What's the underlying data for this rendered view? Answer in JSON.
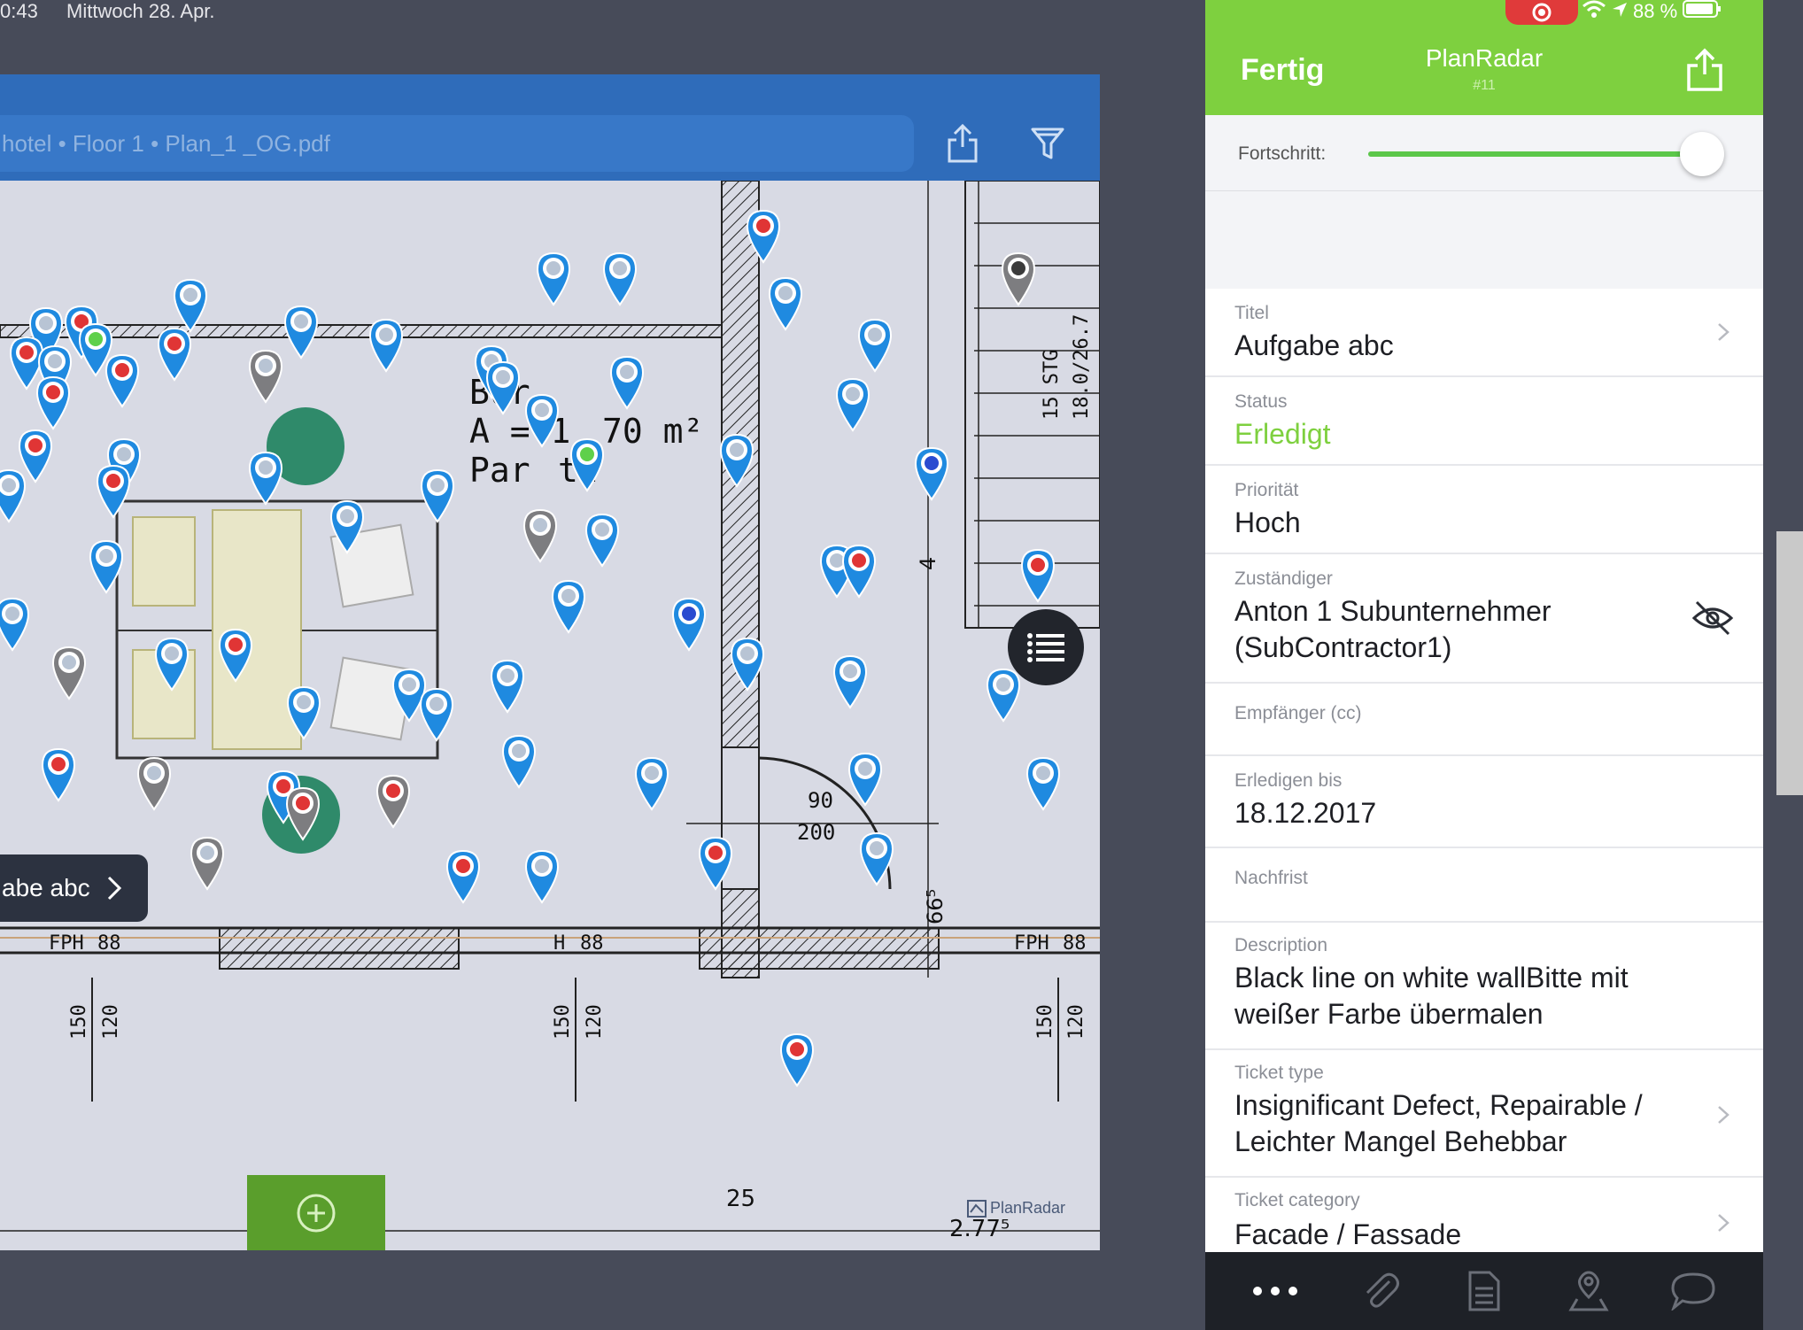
{
  "status_bar": {
    "time": "0:43",
    "date": "Mittwoch 28. Apr.",
    "battery": "88 %"
  },
  "plan": {
    "breadcrumb": "hotel • Floor 1 • Plan_1 _OG.pdf",
    "share_icon": "share-icon",
    "filter_icon": "filter-icon",
    "room_text": [
      "Bür",
      "A = 1",
      "70 m²",
      "Par",
      "tt"
    ],
    "door_dims": [
      "90",
      "200"
    ],
    "stair_text": [
      "15 STG",
      "18.0/26.7"
    ],
    "fph_labels": [
      "FPH",
      "88",
      "FPH",
      "88",
      "H",
      "88"
    ],
    "height_labels": [
      "150",
      "120",
      "150",
      "120",
      "150",
      "120"
    ],
    "dim_25": "25",
    "dim_277": "2.77⁵",
    "dim_665": "66⁵",
    "dim_4": "4",
    "callout_label": "abe abc",
    "watermark": "PlanRadar",
    "add_icon": "plus-circle-icon",
    "list_icon": "list-icon"
  },
  "detail": {
    "done_label": "Fertig",
    "app_title": "PlanRadar",
    "app_subtitle": "#11",
    "progress_label": "Fortschritt:",
    "progress": 1.0,
    "fields": {
      "title_label": "Titel",
      "title_value": "Aufgabe abc",
      "status_label": "Status",
      "status_value": "Erledigt",
      "status_color": "#7ed03f",
      "priority_label": "Priorität",
      "priority_value": "Hoch",
      "assignee_label": "Zuständiger",
      "assignee_value": "Anton 1 Subunternehmer (SubContractor1)",
      "cc_label": "Empfänger (cc)",
      "due_label": "Erledigen bis",
      "due_value": "18.12.2017",
      "grace_label": "Nachfrist",
      "description_label": "Description",
      "description_value": "Black line on white wallBitte mit weißer Farbe übermalen",
      "ticket_type_label": "Ticket type",
      "ticket_type_value": "Insignificant Defect, Repairable / Leichter Mangel Behebbar",
      "ticket_category_label": "Ticket category",
      "ticket_category_value": "Facade / Fassade"
    },
    "tabs": [
      "more-icon",
      "attachment-icon",
      "document-icon",
      "location-pin-icon",
      "comment-icon"
    ]
  },
  "colors": {
    "header_green": "#7ed03f",
    "toolbar_blue": "#2f6cba",
    "pin_blue": "#1e88e5",
    "pin_gray": "#7a7a7a"
  }
}
